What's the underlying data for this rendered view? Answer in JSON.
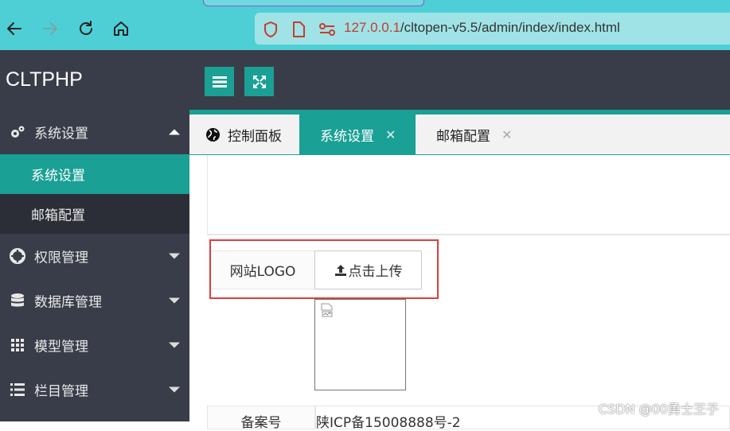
{
  "browser": {
    "url_host": "127.0.0.1",
    "url_path": "/cltopen-v5.5/admin/index/index.html",
    "nav_icons": [
      "back-arrow-icon",
      "forward-arrow-icon",
      "reload-icon",
      "home-icon"
    ],
    "url_icons": [
      "shield-icon",
      "page-icon",
      "permissions-icon"
    ]
  },
  "app": {
    "brand": "CLTPHP",
    "accent_color": "#1aa094",
    "sidebar_bg": "#393d49"
  },
  "sidebar": {
    "items": [
      {
        "label": "系统设置",
        "icon": "gears-icon",
        "expanded": true
      },
      {
        "label": "权限管理",
        "icon": "support-icon",
        "expanded": false
      },
      {
        "label": "数据库管理",
        "icon": "database-icon",
        "expanded": false
      },
      {
        "label": "模型管理",
        "icon": "grid-icon",
        "expanded": false
      },
      {
        "label": "栏目管理",
        "icon": "list-icon",
        "expanded": false
      }
    ],
    "subitems": [
      {
        "label": "系统设置",
        "active": true
      },
      {
        "label": "邮箱配置",
        "active": false
      }
    ]
  },
  "topbar": {
    "buttons": [
      "menu-toggle-icon",
      "fullscreen-icon"
    ]
  },
  "tabs": [
    {
      "label": "控制面板",
      "icon": "globe-icon",
      "active": false,
      "closable": false
    },
    {
      "label": "系统设置",
      "active": true,
      "closable": true
    },
    {
      "label": "邮箱配置",
      "active": false,
      "closable": true
    }
  ],
  "form": {
    "logo_label": "网站LOGO",
    "upload_label": "点击上传",
    "next_label": "备案号",
    "next_value": "陕ICP备15008888号-2"
  },
  "watermark": "CSDN @00勇士王子"
}
